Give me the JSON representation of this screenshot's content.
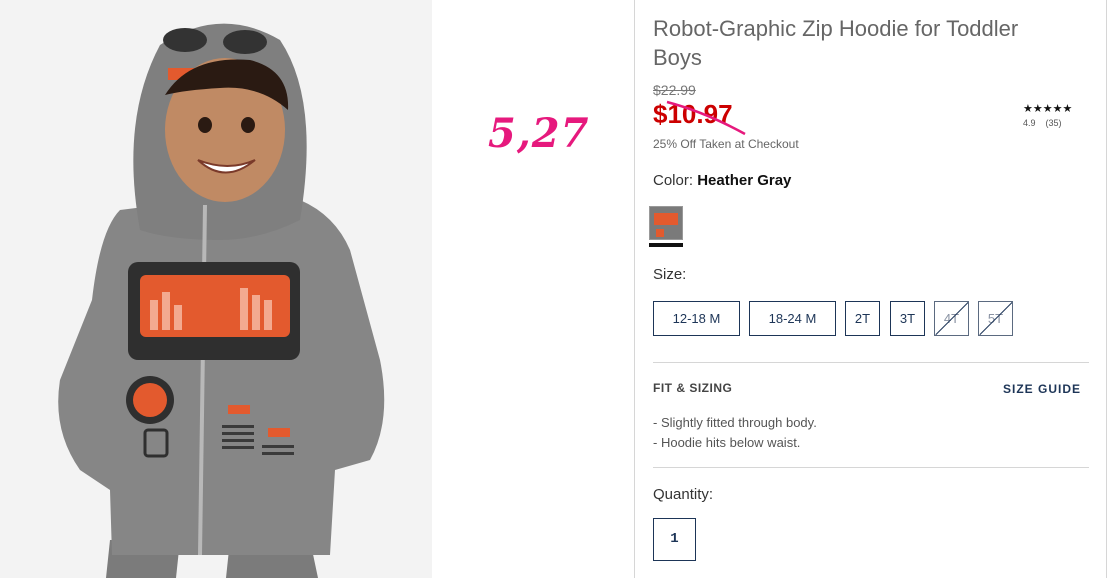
{
  "annotation": "5,27",
  "product": {
    "title": "Robot-Graphic Zip Hoodie for Toddler Boys",
    "old_price": "$22.99",
    "sale_price": "$10.97",
    "promo": "25% Off Taken at Checkout",
    "rating": {
      "stars": "★★★★★",
      "score": "4.9",
      "count": "(35)"
    }
  },
  "color": {
    "label": "Color:",
    "value": "Heather Gray"
  },
  "size": {
    "label": "Size:",
    "options": [
      {
        "label": "12-18 M",
        "available": true
      },
      {
        "label": "18-24 M",
        "available": true
      },
      {
        "label": "2T",
        "available": true
      },
      {
        "label": "3T",
        "available": true
      },
      {
        "label": "4T",
        "available": false
      },
      {
        "label": "5T",
        "available": false
      }
    ]
  },
  "fit": {
    "title": "FIT & SIZING",
    "size_guide": "SIZE GUIDE",
    "items": [
      "Slightly fitted through body.",
      "Hoodie hits below waist."
    ]
  },
  "quantity": {
    "label": "Quantity:",
    "value": "1"
  },
  "colors": {
    "sale": "#cc0000",
    "navy": "#1d3557",
    "annotation": "#e6197d"
  }
}
